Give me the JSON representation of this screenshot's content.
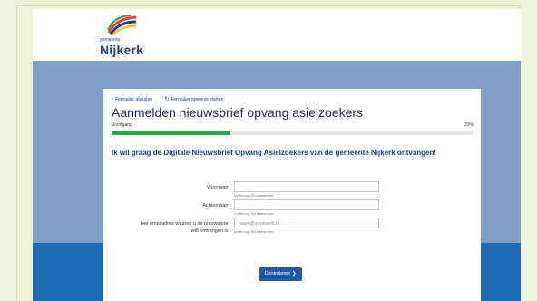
{
  "header": {
    "logo_small": "gemeente",
    "logo_name": "Nijkerk"
  },
  "nav": {
    "back_link": "Formulier afsluiten",
    "restart_link": "Formulier opnieuw starten"
  },
  "form": {
    "title": "Aanmelden nieuwsbrief opvang asielzoekers",
    "progress_label": "Voortgang",
    "progress_percent": "33%",
    "progress_value": 0.33,
    "intro": "Ik wil graag de Digitale Nieuwsbrief Opvang Asielzoekers van de gemeente Nijkerk ontvangen!",
    "fields": {
      "first_name_label": "Voornaam",
      "first_name_hint": "U hebt nog 200 tekens over.",
      "last_name_label": "Achternaam",
      "last_name_hint": "U hebt nog 200 tekens over.",
      "email_label_1": "Het emailadres waarop u de nieuwsbrief",
      "email_label_2": "wilt ontvangen is:",
      "email_placeholder": "naam@voorbeeld.nl",
      "email_hint": "U hebt nog 254 tekens over."
    },
    "submit_label": "Controleren ❯"
  },
  "colors": {
    "background": "#eef2d8",
    "band": "#7f9ec8",
    "band_lower": "#1e6ab4",
    "progress": "#2aa84a",
    "button": "#1e5aa8"
  }
}
